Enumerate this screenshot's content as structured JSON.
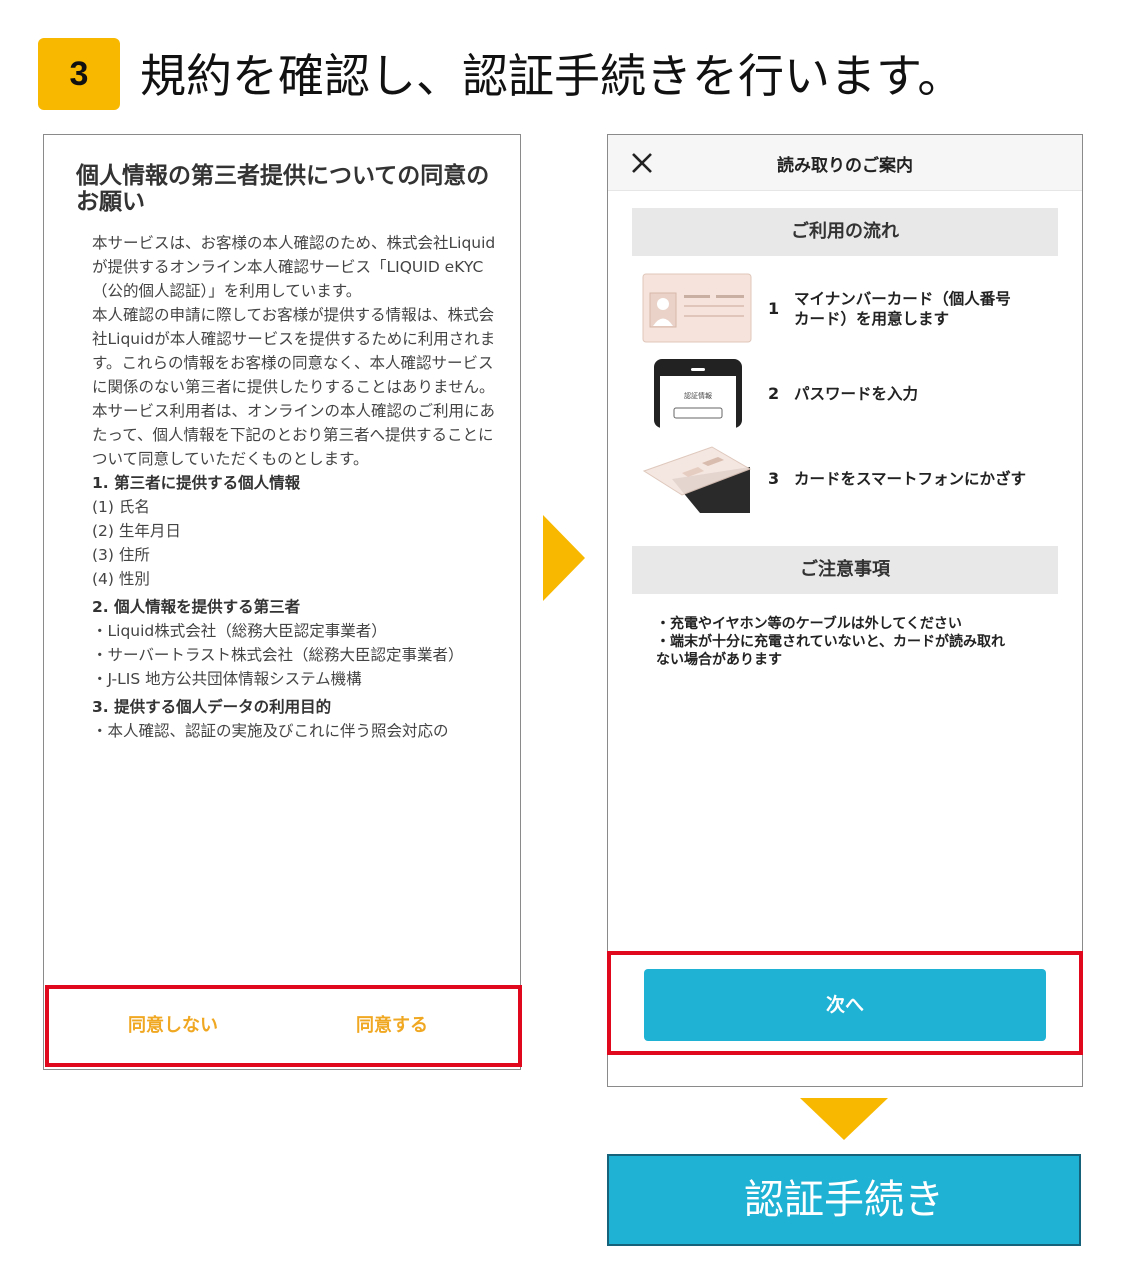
{
  "header": {
    "step_number": "3",
    "title": "規約を確認し、認証手続きを行います。"
  },
  "consent_screen": {
    "title": "個人情報の第三者提供についての同意のお願い",
    "intro_paragraphs": [
      "本サービスは、お客様の本人確認のため、株式会社Liquidが提供するオンライン本人確認サービス「LIQUID eKYC（公的個人認証）」を利用しています。",
      "本人確認の申請に際してお客様が提供する情報は、株式会社Liquidが本人確認サービスを提供するために利用されます。これらの情報をお客様の同意なく、本人確認サービスに関係のない第三者に提供したりすることはありません。",
      "本サービス利用者は、オンラインの本人確認のご利用にあたって、個人情報を下記のとおり第三者へ提供することについて同意していただくものとします。"
    ],
    "section1": {
      "heading": "1. 第三者に提供する個人情報",
      "items": [
        "(1) 氏名",
        "(2) 生年月日",
        "(3) 住所",
        "(4) 性別"
      ]
    },
    "section2": {
      "heading": "2. 個人情報を提供する第三者",
      "items": [
        "・Liquid株式会社（総務大臣認定事業者）",
        "・サーバートラスト株式会社（総務大臣認定事業者）",
        "・J-LIS 地方公共団体情報システム機構"
      ]
    },
    "section3": {
      "heading": "3. 提供する個人データの利用目的",
      "partial_line": "・本人確認、認証の実施及びこれに伴う照会対応の"
    },
    "buttons": {
      "disagree": "同意しない",
      "agree": "同意する"
    }
  },
  "reading_guide_screen": {
    "header_title": "読み取りのご案内",
    "flow_section_title": "ご利用の流れ",
    "steps": [
      {
        "number": "1",
        "text_line1": "マイナンバーカード（個人番号",
        "text_line2": "カード）を用意します"
      },
      {
        "number": "2",
        "text_line1": "パスワードを入力",
        "screen_label": "認証情報"
      },
      {
        "number": "3",
        "text_line1": "カードをスマートフォンにかざす"
      }
    ],
    "notes_section_title": "ご注意事項",
    "notes": [
      "・充電やイヤホン等のケーブルは外してください",
      "・端末が十分に充電されていないと、カードが読み取れ",
      "ない場合があります"
    ],
    "next_button": "次へ"
  },
  "bottom_button": "認証手続き",
  "colors": {
    "accent_yellow": "#f8b800",
    "button_blue": "#1fb2d4",
    "highlight_red": "#e0081c",
    "consent_button_text": "#f0a823"
  }
}
